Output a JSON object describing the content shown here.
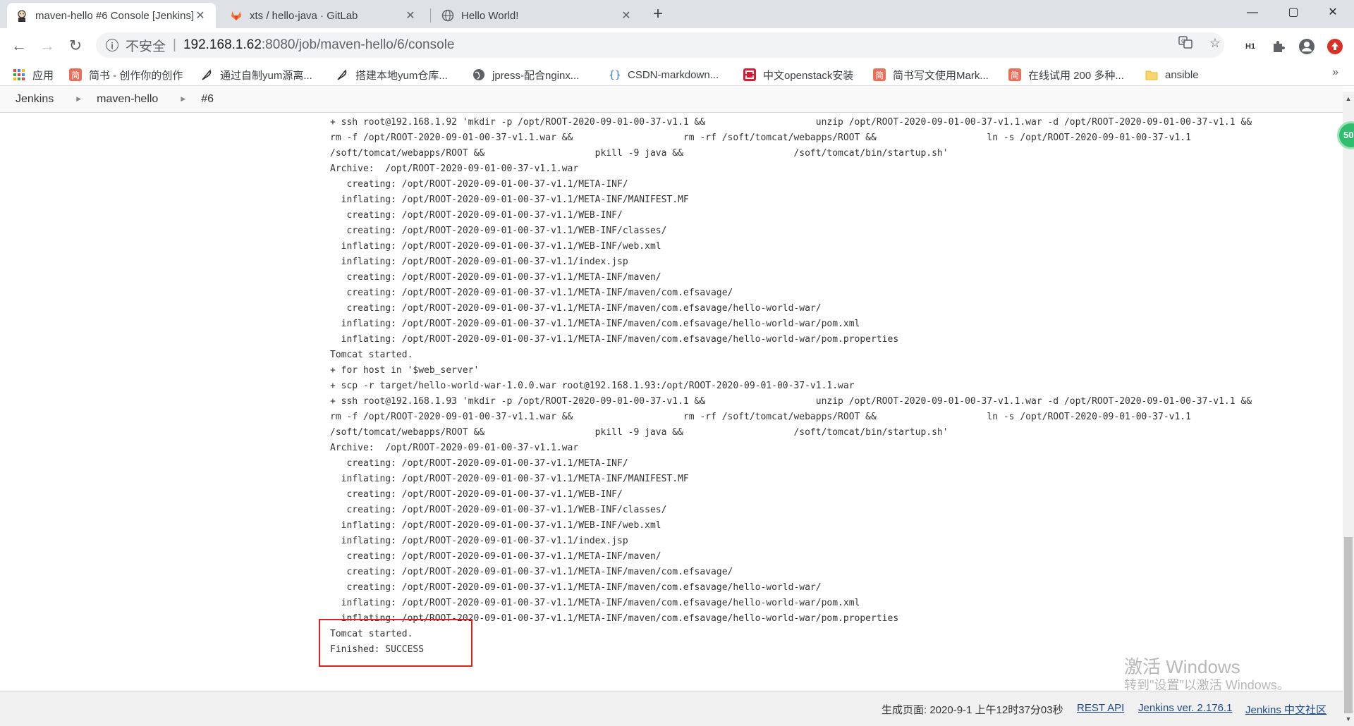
{
  "browser": {
    "tabs": [
      {
        "title": "maven-hello #6 Console [Jenkins]",
        "close": "✕"
      },
      {
        "title": "xts / hello-java · GitLab",
        "close": "✕"
      },
      {
        "title": "Hello World!",
        "close": "✕"
      }
    ],
    "new_tab": "+",
    "window_controls": {
      "minimize": "—",
      "maximize": "▢",
      "close": "✕"
    },
    "nav": {
      "back": "←",
      "forward": "→",
      "reload": "↻"
    },
    "address": {
      "security_label": "不安全",
      "separator": "|",
      "host": "192.168.1.62",
      "path": ":8080/job/maven-hello/6/console"
    },
    "toolbar_icons": [
      "translate-icon",
      "star-icon",
      "h1-extension-icon",
      "puzzle-extensions-icon",
      "account-avatar-icon",
      "update-menu-icon"
    ],
    "ext_h1_text": "H1",
    "bookmarks": [
      {
        "label": "应用",
        "icon": "apps-grid-icon"
      },
      {
        "label": "简书 - 创作你的创作",
        "icon": "jianshu-icon",
        "glyph": "简"
      },
      {
        "label": "通过自制yum源离...",
        "icon": "feather-icon"
      },
      {
        "label": "搭建本地yum仓库...",
        "icon": "feather-icon"
      },
      {
        "label": "jpress-配合nginx...",
        "icon": "globe-icon"
      },
      {
        "label": "CSDN-markdown...",
        "icon": "csdn-icon"
      },
      {
        "label": "中文openstack安装",
        "icon": "openstack-icon"
      },
      {
        "label": "简书写文使用Mark...",
        "icon": "jianshu-icon",
        "glyph": "简"
      },
      {
        "label": "在线试用 200 多种...",
        "icon": "jianshu-icon",
        "glyph": "简"
      },
      {
        "label": "ansible",
        "icon": "folder-icon"
      }
    ],
    "bookmarks_more": "»"
  },
  "breadcrumbs": [
    {
      "label": "Jenkins"
    },
    {
      "label": "maven-hello"
    },
    {
      "label": "#6"
    }
  ],
  "console_lines": [
    "+ ssh root@192.168.1.92 'mkdir -p /opt/ROOT-2020-09-01-00-37-v1.1 &&                    unzip /opt/ROOT-2020-09-01-00-37-v1.1.war -d /opt/ROOT-2020-09-01-00-37-v1.1 &&",
    "rm -f /opt/ROOT-2020-09-01-00-37-v1.1.war &&                    rm -rf /soft/tomcat/webapps/ROOT &&                    ln -s /opt/ROOT-2020-09-01-00-37-v1.1",
    "/soft/tomcat/webapps/ROOT &&                    pkill -9 java &&                    /soft/tomcat/bin/startup.sh'",
    "Archive:  /opt/ROOT-2020-09-01-00-37-v1.1.war",
    "   creating: /opt/ROOT-2020-09-01-00-37-v1.1/META-INF/",
    "  inflating: /opt/ROOT-2020-09-01-00-37-v1.1/META-INF/MANIFEST.MF",
    "   creating: /opt/ROOT-2020-09-01-00-37-v1.1/WEB-INF/",
    "   creating: /opt/ROOT-2020-09-01-00-37-v1.1/WEB-INF/classes/",
    "  inflating: /opt/ROOT-2020-09-01-00-37-v1.1/WEB-INF/web.xml",
    "  inflating: /opt/ROOT-2020-09-01-00-37-v1.1/index.jsp",
    "   creating: /opt/ROOT-2020-09-01-00-37-v1.1/META-INF/maven/",
    "   creating: /opt/ROOT-2020-09-01-00-37-v1.1/META-INF/maven/com.efsavage/",
    "   creating: /opt/ROOT-2020-09-01-00-37-v1.1/META-INF/maven/com.efsavage/hello-world-war/",
    "  inflating: /opt/ROOT-2020-09-01-00-37-v1.1/META-INF/maven/com.efsavage/hello-world-war/pom.xml",
    "  inflating: /opt/ROOT-2020-09-01-00-37-v1.1/META-INF/maven/com.efsavage/hello-world-war/pom.properties",
    "Tomcat started.",
    "+ for host in '$web_server'",
    "+ scp -r target/hello-world-war-1.0.0.war root@192.168.1.93:/opt/ROOT-2020-09-01-00-37-v1.1.war",
    "+ ssh root@192.168.1.93 'mkdir -p /opt/ROOT-2020-09-01-00-37-v1.1 &&                    unzip /opt/ROOT-2020-09-01-00-37-v1.1.war -d /opt/ROOT-2020-09-01-00-37-v1.1 &&",
    "rm -f /opt/ROOT-2020-09-01-00-37-v1.1.war &&                    rm -rf /soft/tomcat/webapps/ROOT &&                    ln -s /opt/ROOT-2020-09-01-00-37-v1.1",
    "/soft/tomcat/webapps/ROOT &&                    pkill -9 java &&                    /soft/tomcat/bin/startup.sh'",
    "Archive:  /opt/ROOT-2020-09-01-00-37-v1.1.war",
    "   creating: /opt/ROOT-2020-09-01-00-37-v1.1/META-INF/",
    "  inflating: /opt/ROOT-2020-09-01-00-37-v1.1/META-INF/MANIFEST.MF",
    "   creating: /opt/ROOT-2020-09-01-00-37-v1.1/WEB-INF/",
    "   creating: /opt/ROOT-2020-09-01-00-37-v1.1/WEB-INF/classes/",
    "  inflating: /opt/ROOT-2020-09-01-00-37-v1.1/WEB-INF/web.xml",
    "  inflating: /opt/ROOT-2020-09-01-00-37-v1.1/index.jsp",
    "   creating: /opt/ROOT-2020-09-01-00-37-v1.1/META-INF/maven/",
    "   creating: /opt/ROOT-2020-09-01-00-37-v1.1/META-INF/maven/com.efsavage/",
    "   creating: /opt/ROOT-2020-09-01-00-37-v1.1/META-INF/maven/com.efsavage/hello-world-war/",
    "  inflating: /opt/ROOT-2020-09-01-00-37-v1.1/META-INF/maven/com.efsavage/hello-world-war/pom.xml",
    "  inflating: /opt/ROOT-2020-09-01-00-37-v1.1/META-INF/maven/com.efsavage/hello-world-war/pom.properties",
    "Tomcat started.",
    "Finished: SUCCESS"
  ],
  "footer": {
    "generated": "生成页面: 2020-9-1 上午12时37分03秒",
    "rest_api": "REST API",
    "version": "Jenkins ver. 2.176.1",
    "community": "Jenkins 中文社区"
  },
  "watermark": {
    "line1": "激活 Windows",
    "line2": "转到\"设置\"以激活 Windows。"
  },
  "floating_badge": "50",
  "colors": {
    "highlight_box": "#e02020",
    "link": "#204a87",
    "badge": "#2fbe6e"
  }
}
